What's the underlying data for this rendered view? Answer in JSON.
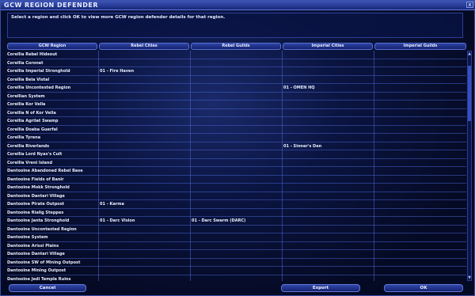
{
  "window": {
    "title": "GCW REGION DEFENDER",
    "close_glyph": "x"
  },
  "instructions": "Select a region and click OK to view more GCW region defender details for that region.",
  "columns": [
    "GCW Region",
    "Rebel Cities",
    "Rebel Guilds",
    "Imperial Cities",
    "Imperial Guilds"
  ],
  "rows": [
    [
      "Corellia Rebel Hideout",
      "",
      "",
      "",
      ""
    ],
    [
      "Corellia Coronet",
      "",
      "",
      "",
      ""
    ],
    [
      "Corellia Imperial Stronghold",
      "01 - Fire Haven",
      "",
      "",
      ""
    ],
    [
      "Corellia Bela Vistal",
      "",
      "",
      "",
      ""
    ],
    [
      "Corellia Uncontested Region",
      "",
      "",
      "01 - OMEN HQ",
      ""
    ],
    [
      "Corellian System",
      "",
      "",
      "",
      ""
    ],
    [
      "Corellia Kor Vella",
      "",
      "",
      "",
      ""
    ],
    [
      "Corellia N of Kor Vella",
      "",
      "",
      "",
      ""
    ],
    [
      "Corellia Agrilat Swamp",
      "",
      "",
      "",
      ""
    ],
    [
      "Corellia Doaba Guerfel",
      "",
      "",
      "",
      ""
    ],
    [
      "Corellia Tyrena",
      "",
      "",
      "",
      ""
    ],
    [
      "Corellia Riverlands",
      "",
      "",
      "01 - Sinner's Den",
      ""
    ],
    [
      "Corellia Lord Nyax's Cult",
      "",
      "",
      "",
      ""
    ],
    [
      "Corellia Vreni Island",
      "",
      "",
      "",
      ""
    ],
    [
      "Dantooine Abandoned Rebel Base",
      "",
      "",
      "",
      ""
    ],
    [
      "Dantooine Fields of Banir",
      "",
      "",
      "",
      ""
    ],
    [
      "Dantooine Mokk Stronghold",
      "",
      "",
      "",
      ""
    ],
    [
      "Dantooine Dantari Village",
      "",
      "",
      "",
      ""
    ],
    [
      "Dantooine Pirate Outpost",
      "01 - Karma",
      "",
      "",
      ""
    ],
    [
      "Dantooine Rialig Steppes",
      "",
      "",
      "",
      ""
    ],
    [
      "Dantooine Janta Stronghold",
      "01 - Darc Vision",
      "01 - Darc Swarm (DARC)",
      "",
      ""
    ],
    [
      "Dantooine Uncontested Region",
      "",
      "",
      "",
      ""
    ],
    [
      "Dantooine System",
      "",
      "",
      "",
      ""
    ],
    [
      "Dantooine Arissi Plains",
      "",
      "",
      "",
      ""
    ],
    [
      "Dantooine Dantari Village",
      "",
      "",
      "",
      ""
    ],
    [
      "Dantooine SW of Mining Outpost",
      "",
      "",
      "",
      ""
    ],
    [
      "Dantooine Mining Outpost",
      "",
      "",
      "",
      ""
    ],
    [
      "Dantooine Jedi Temple Ruins",
      "",
      "",
      "",
      ""
    ]
  ],
  "buttons": {
    "cancel": "Cancel",
    "export": "Export",
    "ok": "OK"
  },
  "colors": {
    "accent": "#3550c0",
    "background": "#050a22",
    "text": "#e8edff"
  }
}
